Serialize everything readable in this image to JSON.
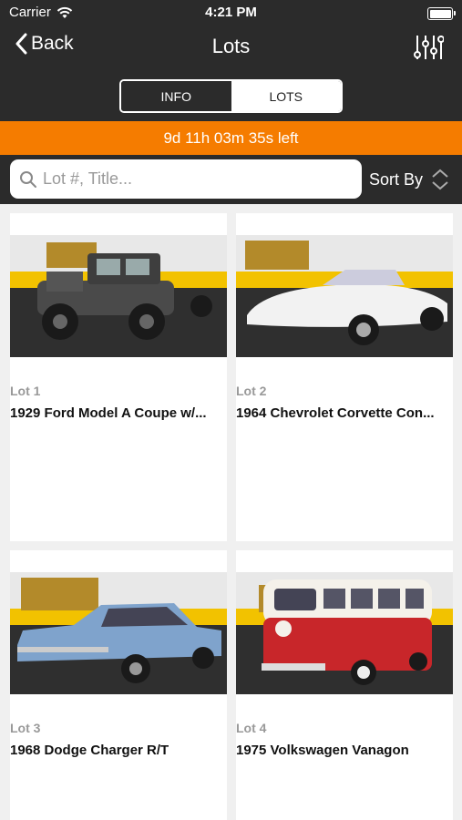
{
  "status_bar": {
    "carrier": "Carrier",
    "time": "4:21 PM"
  },
  "nav": {
    "back_label": "Back",
    "title": "Lots"
  },
  "segments": {
    "info": "INFO",
    "lots": "LOTS",
    "selected": "LOTS"
  },
  "countdown": {
    "text": "9d 11h 03m 35s left"
  },
  "search": {
    "placeholder": "Lot #, Title...",
    "value": ""
  },
  "sort": {
    "label": "Sort By"
  },
  "lots": [
    {
      "lot": "Lot 1",
      "title": "1929 Ford Model A Coupe w/...",
      "image": "car-photo",
      "car_color": "#4a4a4a"
    },
    {
      "lot": "Lot 2",
      "title": "1964 Chevrolet Corvette Con...",
      "image": "car-photo",
      "car_color": "#f2f2f2"
    },
    {
      "lot": "Lot 3",
      "title": "1968 Dodge Charger R/T",
      "image": "car-photo",
      "car_color": "#7fa3cc"
    },
    {
      "lot": "Lot 4",
      "title": "1975 Volkswagen Vanagon",
      "image": "van-photo",
      "car_color": "#c8262a"
    }
  ],
  "colors": {
    "header_bg": "#2b2b2b",
    "countdown_bg": "#f57c00",
    "grid_bg": "#f0f0f0"
  }
}
